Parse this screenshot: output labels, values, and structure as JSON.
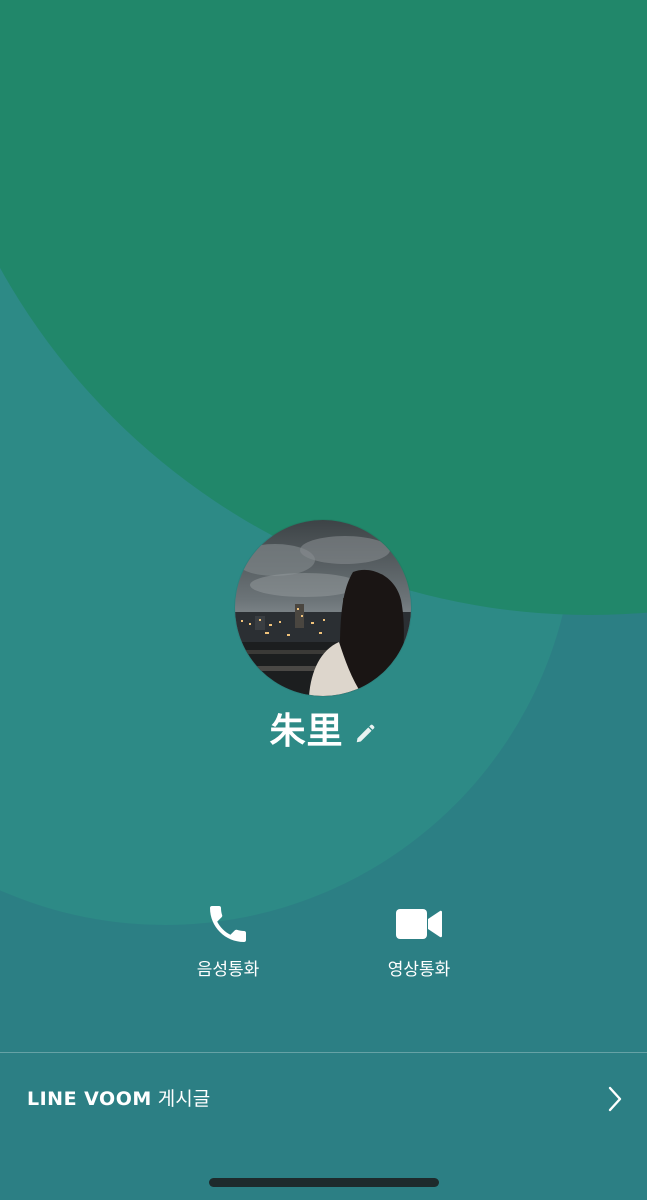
{
  "theme": {
    "background_base": "#2c7f84",
    "background_top": "#21876a",
    "background_middle": "#2d8a86",
    "text_color": "#ffffff"
  },
  "profile": {
    "name": "朱里",
    "avatar_description": "photo-avatar"
  },
  "actions": {
    "voice_call_label": "음성통화",
    "video_call_label": "영상통화"
  },
  "voom": {
    "brand": "LINE VOOM",
    "suffix": " 게시글"
  },
  "icons": {
    "edit": "pencil-icon",
    "voice_call": "phone-icon",
    "video_call": "video-camera-icon",
    "chevron": "chevron-right-icon"
  }
}
